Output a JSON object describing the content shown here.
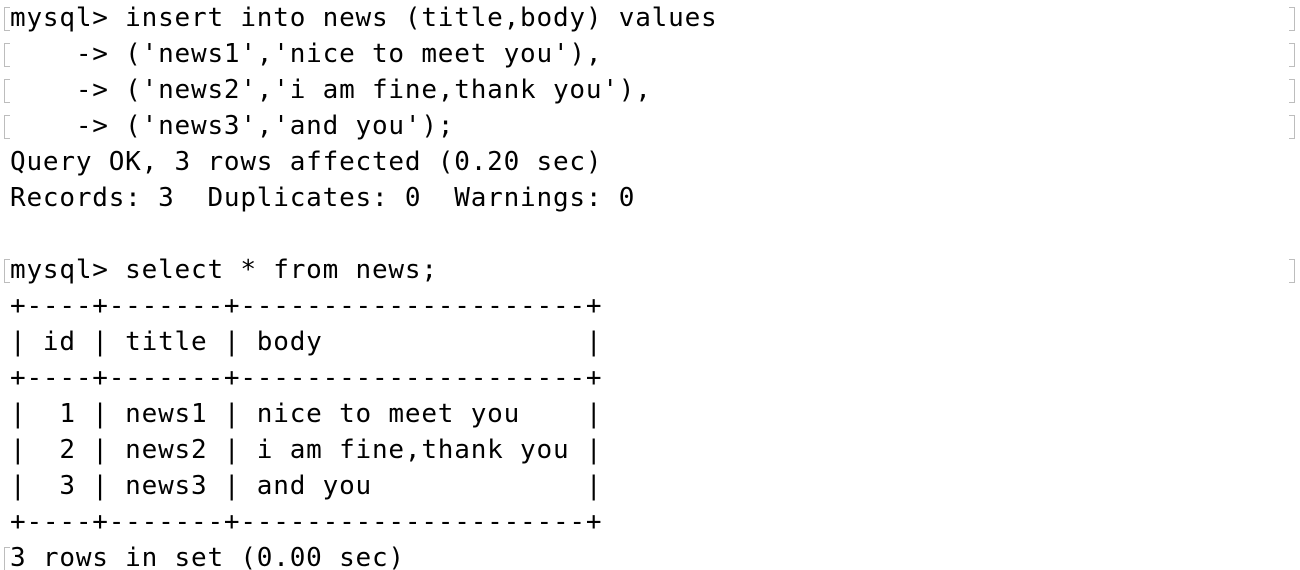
{
  "terminal": {
    "lines": [
      "mysql> insert into news (title,body) values",
      "    -> ('news1','nice to meet you'),",
      "    -> ('news2','i am fine,thank you'),",
      "    -> ('news3','and you');",
      "Query OK, 3 rows affected (0.20 sec)",
      "Records: 3  Duplicates: 0  Warnings: 0",
      "",
      "mysql> select * from news;",
      "+----+-------+---------------------+",
      "| id | title | body                |",
      "+----+-------+---------------------+",
      "|  1 | news1 | nice to meet you    |",
      "|  2 | news2 | i am fine,thank you |",
      "|  3 | news3 | and you             |",
      "+----+-------+---------------------+",
      "3 rows in set (0.00 sec)"
    ]
  }
}
